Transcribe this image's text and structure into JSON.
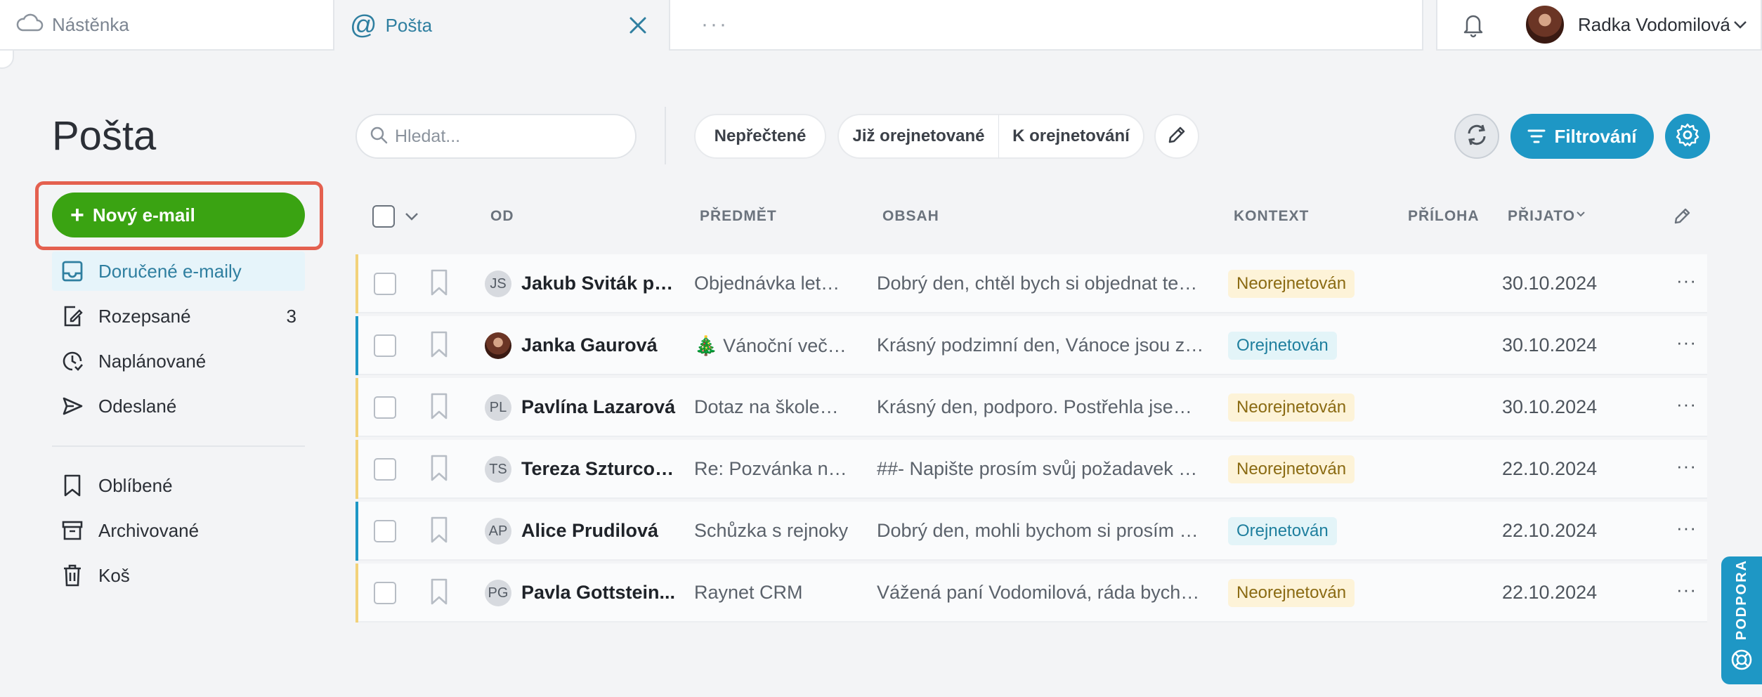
{
  "tabs": {
    "dashboard": {
      "label": "Nástěnka"
    },
    "mail": {
      "label": "Pošta"
    },
    "more": "···"
  },
  "user": {
    "name": "Radka Vodomilová"
  },
  "page": {
    "title": "Pošta"
  },
  "compose": {
    "label": "Nový e-mail"
  },
  "nav": {
    "inbox": "Doručené e-maily",
    "drafts": "Rozepsané",
    "drafts_count": "3",
    "scheduled": "Naplánované",
    "sent": "Odeslané",
    "favorites": "Oblíbené",
    "archived": "Archivované",
    "trash": "Koš"
  },
  "toolbar": {
    "search_placeholder": "Hledat...",
    "unread": "Nepřečtené",
    "answered": "Již orejnetované",
    "to_answer": "K orejnetování",
    "filter": "Filtrování"
  },
  "table": {
    "headers": {
      "from": "OD",
      "subject": "PŘEDMĚT",
      "content": "OBSAH",
      "context": "KONTEXT",
      "attachment": "PŘÍLOHA",
      "received": "PŘIJATO"
    },
    "rows": [
      {
        "initials": "JS",
        "from": "Jakub Sviták po...",
        "subject": "Objednávka letní...",
        "content": "Dobrý den, chtěl bych si objednat ten l...",
        "context": "Neorejnetován",
        "date": "30.10.2024"
      },
      {
        "initials": "",
        "from": "Janka Gaurová",
        "subject": "🎄 Vánoční večíre...",
        "content": "Krásný podzimní den, Vánoce jsou za ...",
        "context": "Orejnetován",
        "date": "30.10.2024"
      },
      {
        "initials": "PL",
        "from": "Pavlína Lazarová",
        "subject": "Dotaz na školení ...",
        "content": "Krásný den, podporo. Postřehla jsem, ...",
        "context": "Neorejnetován",
        "date": "30.10.2024"
      },
      {
        "initials": "TS",
        "from": "Tereza Szturcová",
        "subject": "Re: Pozvánka na ...",
        "content": "##- Napište prosím svůj požadavek na...",
        "context": "Neorejnetován",
        "date": "22.10.2024"
      },
      {
        "initials": "AP",
        "from": "Alice Prudilová",
        "subject": "Schůzka s rejnoky",
        "content": "Dobrý den, mohli bychom si prosím do...",
        "context": "Orejnetován",
        "date": "22.10.2024"
      },
      {
        "initials": "PG",
        "from": "Pavla Gottstein...",
        "subject": "Raynet CRM",
        "content": "Vážená paní Vodomilová, ráda bych V...",
        "context": "Neorejnetován",
        "date": "22.10.2024"
      }
    ]
  },
  "support": {
    "label": "PODPORA"
  },
  "colors": {
    "accent": "#1e97c5",
    "compose_green": "#3aa312",
    "highlight_red": "#e4604f",
    "unanswered_stripe": "#f2d27a",
    "answered_stripe": "#1e97c5"
  }
}
